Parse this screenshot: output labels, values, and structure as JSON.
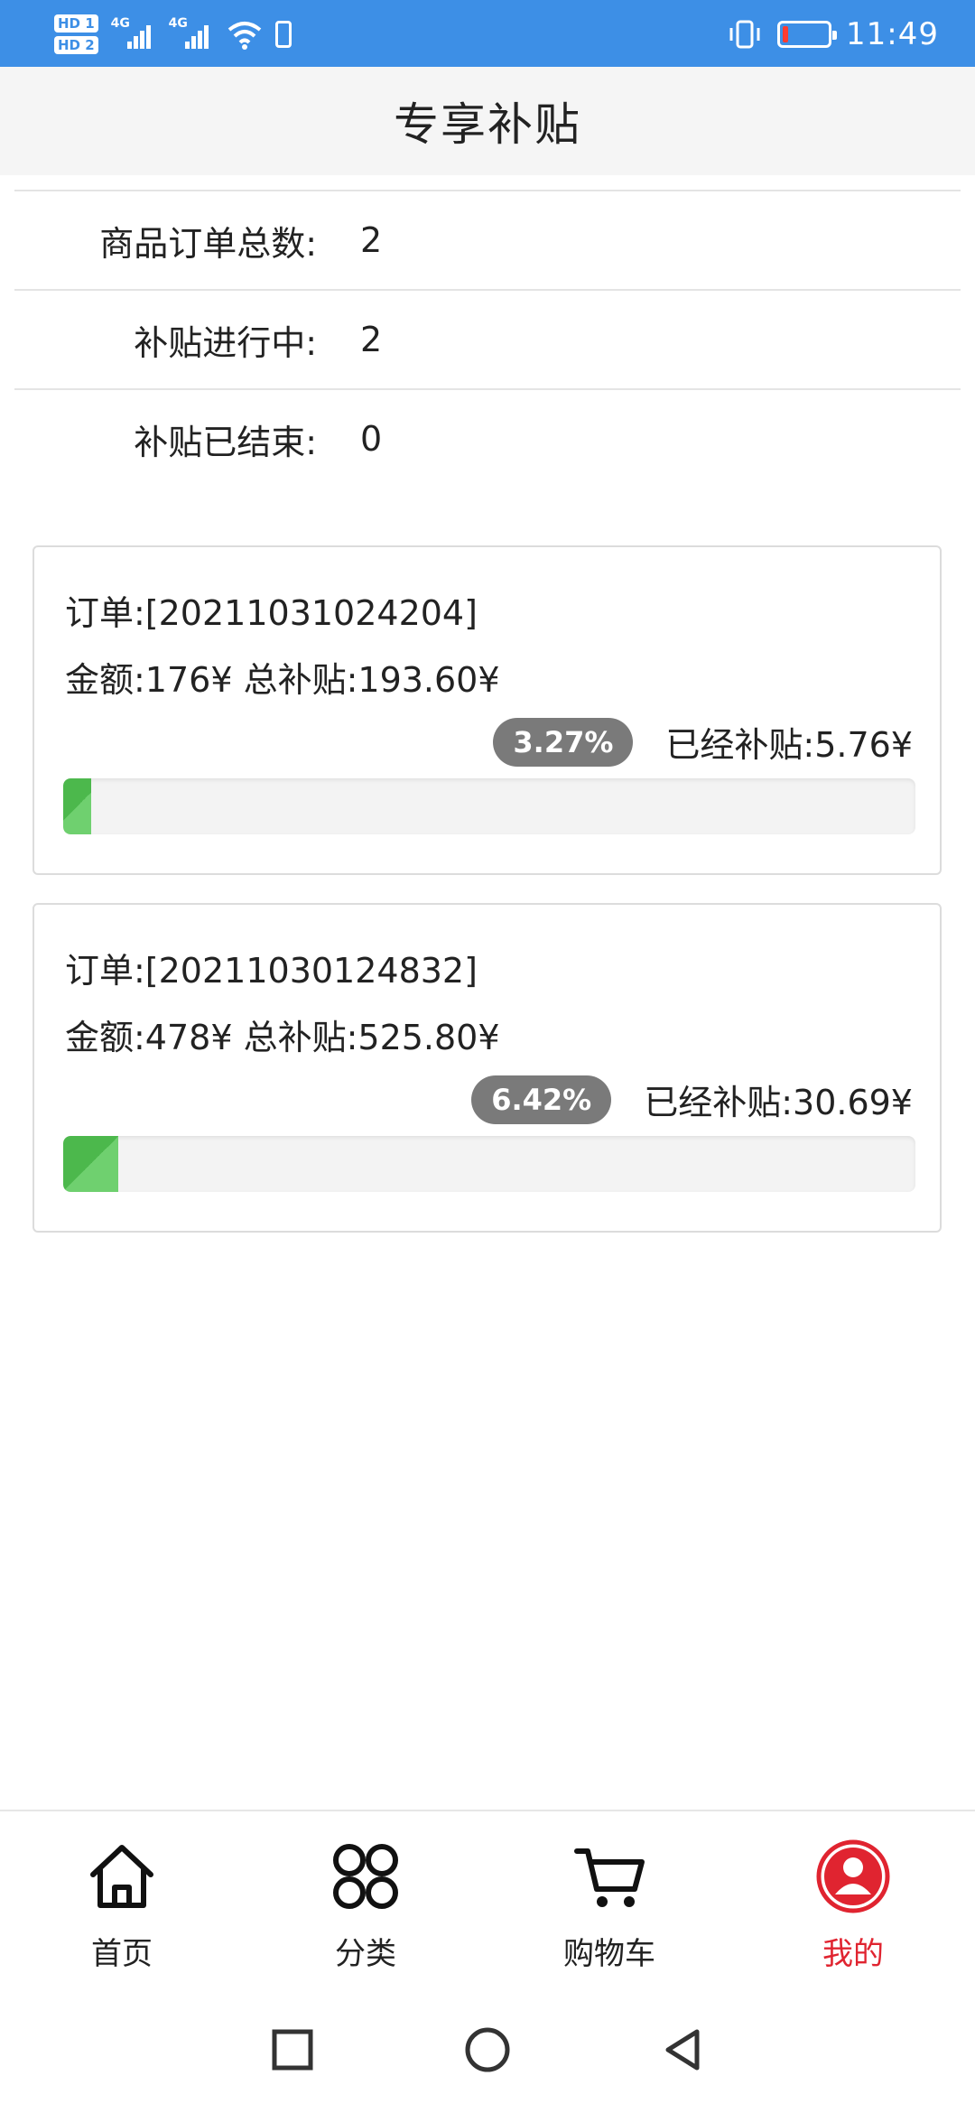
{
  "status_bar": {
    "hd1": "HD 1",
    "hd2": "HD 2",
    "net1": "4G",
    "net2": "4G",
    "time": "11:49"
  },
  "header": {
    "title": "专享补贴"
  },
  "summary": [
    {
      "label": "商品订单总数:",
      "value": "2"
    },
    {
      "label": "补贴进行中:",
      "value": "2"
    },
    {
      "label": "补贴已结束:",
      "value": "0"
    }
  ],
  "orders": [
    {
      "order_text": "订单:[20211031024204]",
      "amount_text": "金额:176¥ 总补贴:193.60¥",
      "percent_label": "3.27%",
      "progress_percent": 3.27,
      "subsidized_text": "已经补贴:5.76¥"
    },
    {
      "order_text": "订单:[20211030124832]",
      "amount_text": "金额:478¥ 总补贴:525.80¥",
      "percent_label": "6.42%",
      "progress_percent": 6.42,
      "subsidized_text": "已经补贴:30.69¥"
    }
  ],
  "bottom_nav": [
    {
      "label": "首页",
      "icon": "home-icon"
    },
    {
      "label": "分类",
      "icon": "category-icon"
    },
    {
      "label": "购物车",
      "icon": "cart-icon"
    },
    {
      "label": "我的",
      "icon": "profile-icon",
      "active": true
    }
  ],
  "colors": {
    "status_bar": "#3d8fe6",
    "progress": "#4cb84c",
    "active_tab": "#e02430",
    "badge": "#7a7a7a"
  }
}
